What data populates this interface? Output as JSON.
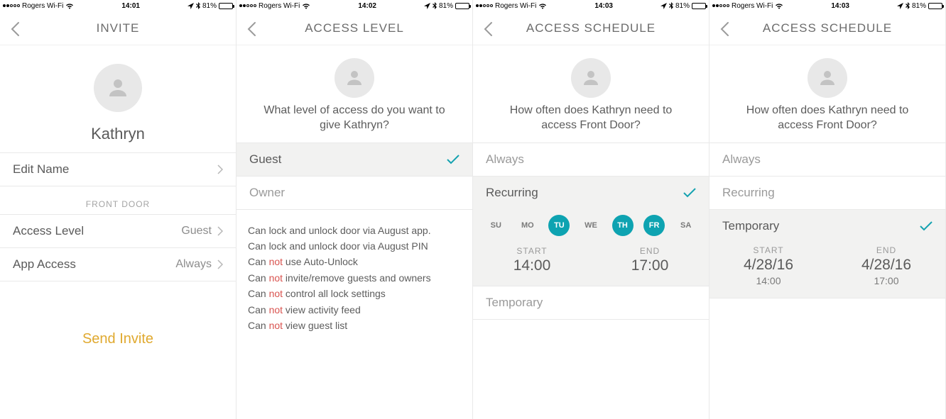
{
  "status": {
    "carrier": "Rogers Wi-Fi",
    "battery_pct": "81%",
    "times": [
      "14:01",
      "14:02",
      "14:03",
      "14:03"
    ]
  },
  "s1": {
    "title": "INVITE",
    "name": "Kathryn",
    "edit_name": "Edit Name",
    "section": "FRONT DOOR",
    "row_access_level_label": "Access Level",
    "row_access_level_value": "Guest",
    "row_app_access_label": "App Access",
    "row_app_access_value": "Always",
    "send_invite": "Send Invite"
  },
  "s2": {
    "title": "ACCESS LEVEL",
    "prompt": "What level of access do you want to give Kathryn?",
    "opt_guest": "Guest",
    "opt_owner": "Owner",
    "perms": {
      "p1": "Can lock and unlock door via August app.",
      "p2": "Can lock and unlock door via August PIN",
      "p3a": "Can ",
      "p3b": "not",
      "p3c": " use Auto-Unlock",
      "p4a": "Can ",
      "p4b": "not",
      "p4c": " invite/remove guests and owners",
      "p5a": "Can ",
      "p5b": "not",
      "p5c": " control all lock settings",
      "p6a": "Can ",
      "p6b": "not",
      "p6c": " view activity feed",
      "p7a": "Can ",
      "p7b": "not",
      "p7c": " view guest list"
    }
  },
  "s3": {
    "title": "ACCESS SCHEDULE",
    "prompt": "How often does Kathryn need to access Front Door?",
    "opt_always": "Always",
    "opt_recurring": "Recurring",
    "opt_temporary": "Temporary",
    "days": {
      "SU": "SU",
      "MO": "MO",
      "TU": "TU",
      "WE": "WE",
      "TH": "TH",
      "FR": "FR",
      "SA": "SA"
    },
    "start_lbl": "START",
    "end_lbl": "END",
    "start_val": "14:00",
    "end_val": "17:00"
  },
  "s4": {
    "title": "ACCESS SCHEDULE",
    "prompt": "How often does Kathryn need to access Front Door?",
    "opt_always": "Always",
    "opt_recurring": "Recurring",
    "opt_temporary": "Temporary",
    "start_lbl": "START",
    "end_lbl": "END",
    "start_date": "4/28/16",
    "end_date": "4/28/16",
    "start_time": "14:00",
    "end_time": "17:00"
  }
}
